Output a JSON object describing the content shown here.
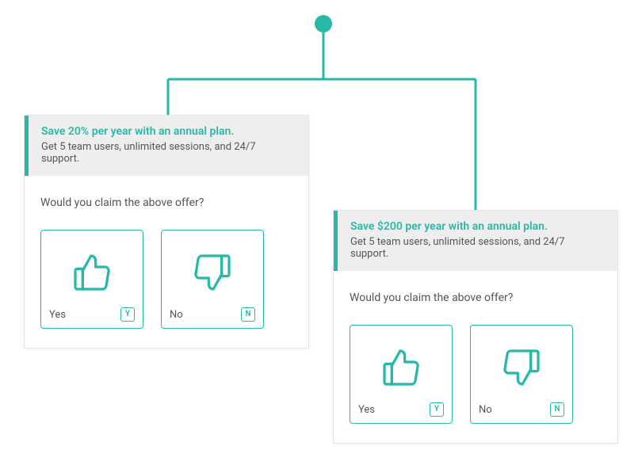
{
  "cards": {
    "a": {
      "offer_title": "Save 20% per year with an annual plan.",
      "offer_sub": "Get 5 team users, unlimited sessions, and 24/7 support.",
      "question": "Would you claim the above offer?",
      "yes_label": "Yes",
      "yes_key": "Y",
      "no_label": "No",
      "no_key": "N"
    },
    "b": {
      "offer_title": "Save $200 per year with an annual plan.",
      "offer_sub": "Get 5 team users, unlimited sessions, and 24/7 support.",
      "question": "Would you claim the above offer?",
      "yes_label": "Yes",
      "yes_key": "Y",
      "no_label": "No",
      "no_key": "N"
    }
  },
  "colors": {
    "accent": "#26b9a7"
  }
}
